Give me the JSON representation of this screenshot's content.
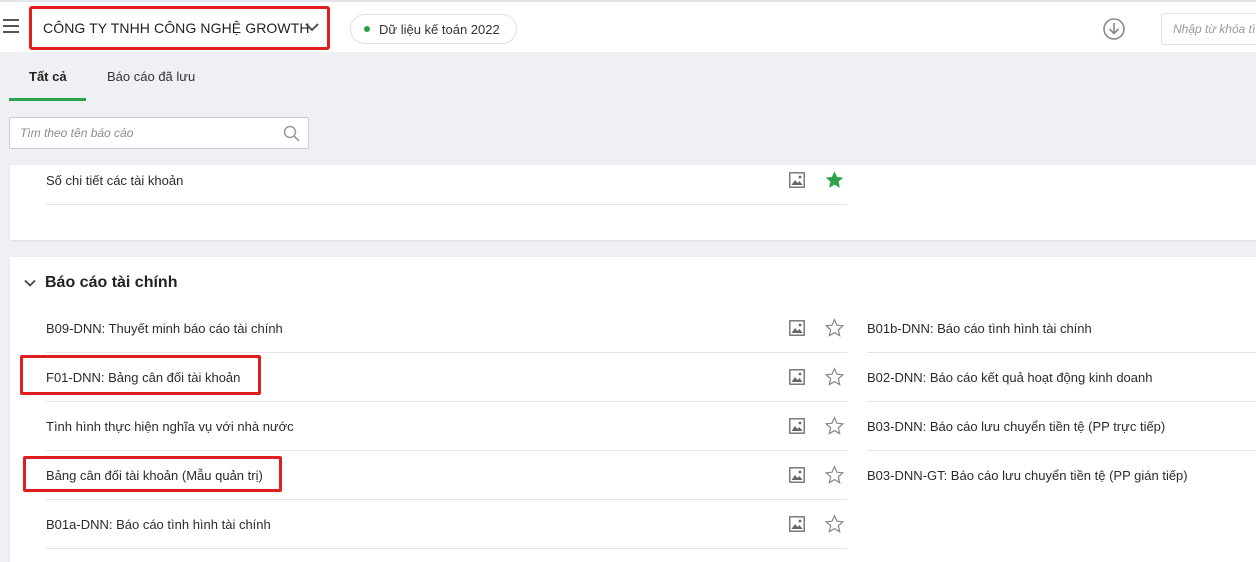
{
  "header": {
    "company_name": "CÔNG TY TNHH CÔNG NGHỆ GROWTH",
    "data_year_label": "Dữ liệu kế toán 2022",
    "search_placeholder": "Nhập từ khóa tì"
  },
  "tabs": [
    {
      "label": "Tất cả",
      "active": true
    },
    {
      "label": "Báo cáo đã lưu",
      "active": false
    }
  ],
  "report_search": {
    "placeholder": "Tìm theo tên báo cáo"
  },
  "top_section": {
    "items": [
      {
        "label": "Số chi tiết các tài khoản",
        "starred": true
      }
    ]
  },
  "financial_section": {
    "title": "Báo cáo tài chính",
    "left_items": [
      {
        "label": "B09-DNN: Thuyết minh báo cáo tài chính",
        "starred": false
      },
      {
        "label": "F01-DNN: Bảng cân đối tài khoản",
        "starred": false
      },
      {
        "label": "Tình hình thực hiện nghĩa vụ với nhà nước",
        "starred": false
      },
      {
        "label": "Bảng cân đối tài khoản (Mẫu quản trị)",
        "starred": false
      },
      {
        "label": "B01a-DNN: Báo cáo tình hình tài chính",
        "starred": false
      }
    ],
    "right_items": [
      {
        "label": "B01b-DNN: Báo cáo tình hình tài chính"
      },
      {
        "label": "B02-DNN: Báo cáo kết quả hoạt động kinh doanh"
      },
      {
        "label": "B03-DNN: Báo cáo lưu chuyển tiền tệ (PP trực tiếp)"
      },
      {
        "label": "B03-DNN-GT: Báo cáo lưu chuyển tiền tệ (PP gián tiếp)"
      }
    ]
  },
  "colors": {
    "accent": "#2aa14a",
    "highlight": "#e01e1e",
    "star_filled": "#2aa14a"
  }
}
